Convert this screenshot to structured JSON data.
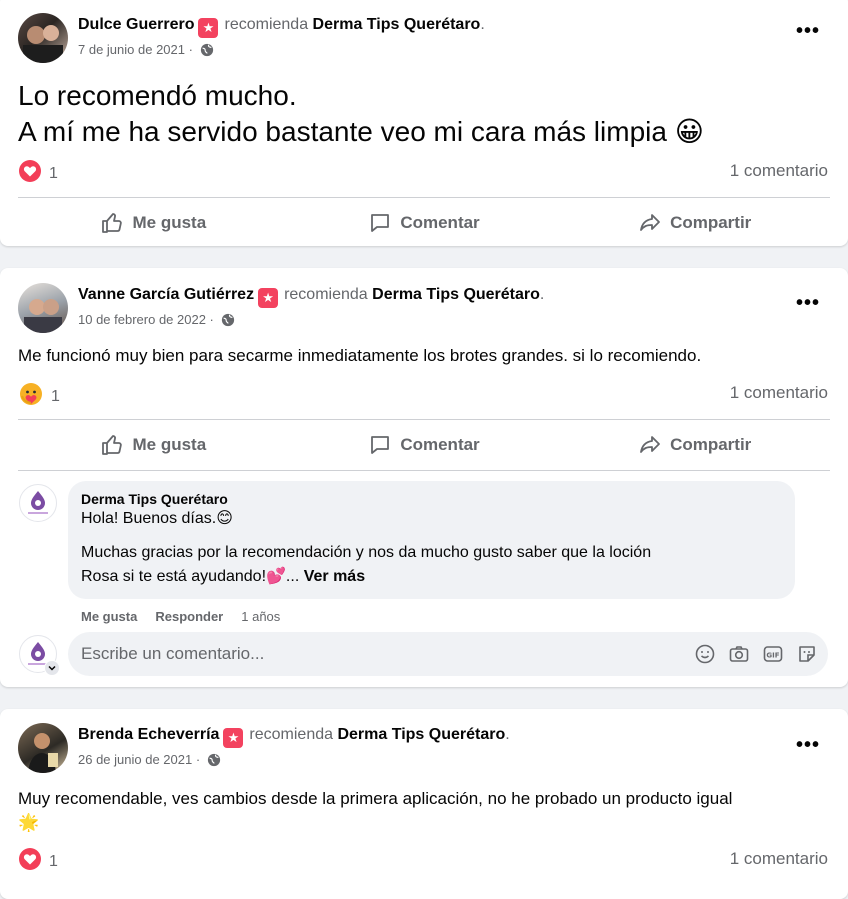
{
  "posts": [
    {
      "author": "Dulce Guerrero",
      "recommends": "recomienda",
      "page": "Derma Tips Querétaro",
      "date": "7 de junio de 2021",
      "text_line1": "Lo recomendó mucho.",
      "text_line2": "A mí me ha servido bastante veo mi cara más limpia",
      "text_emoji": "😀",
      "reaction": "love",
      "reaction_count": "1",
      "comments_count": "1 comentario"
    },
    {
      "author": "Vanne García Gutiérrez",
      "recommends": "recomienda",
      "page": "Derma Tips Querétaro",
      "date": "10 de febrero de 2022",
      "text": "Me funcionó muy bien para secarme inmediatamente los brotes grandes. si lo recomiendo.",
      "reaction": "care",
      "reaction_count": "1",
      "comments_count": "1 comentario",
      "comment": {
        "author": "Derma Tips Querétaro",
        "line1": "Hola! Buenos días.😊",
        "line2": "Muchas gracias por la recomendación y nos da mucho gusto saber que la loción",
        "line3": "Rosa si te está ayudando!💕...",
        "see_more": "Ver más",
        "like": "Me gusta",
        "reply": "Responder",
        "age": "1 años"
      },
      "write_placeholder": "Escribe un comentario..."
    },
    {
      "author": "Brenda Echeverría",
      "recommends": "recomienda",
      "page": "Derma Tips Querétaro",
      "date": "26 de junio de 2021",
      "text": "Muy recomendable, ves cambios desde la primera aplicación, no he probado un producto igual",
      "text_emoji": "🌟",
      "reaction": "love",
      "reaction_count": "1",
      "comments_count": "1 comentario"
    }
  ],
  "actions": {
    "like": "Me gusta",
    "comment": "Comentar",
    "share": "Compartir"
  },
  "icons": [
    "star-badge-icon",
    "globe-icon",
    "more-options-icon",
    "love-reaction-icon",
    "care-reaction-icon",
    "like-icon",
    "comment-icon",
    "share-icon",
    "emoji-icon",
    "camera-icon",
    "gif-icon",
    "sticker-icon",
    "chevron-down-icon"
  ],
  "colors": {
    "background": "#f0f2f5",
    "badge": "#f3425f",
    "secondary_text": "#65676b",
    "love": "#f33e58"
  }
}
